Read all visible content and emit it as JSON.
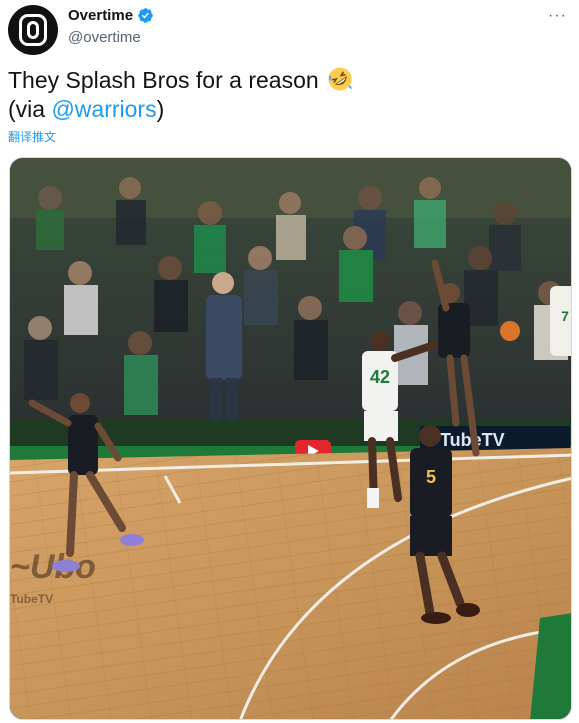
{
  "tweet": {
    "author": {
      "display_name": "Overtime",
      "handle": "@overtime",
      "verified": true,
      "avatar_icon": "overtime-logo-icon"
    },
    "more_label": "···",
    "text_line1": "They Splash Bros for a reason",
    "emoji_icon": "rolling-on-floor-laughing-icon",
    "via_prefix": "(via ",
    "mention": "@warriors",
    "via_suffix": ")",
    "translate_label": "翻译推文",
    "media": {
      "type": "video-frame",
      "scoreboard_brand": "TubeTV",
      "court_brand": "TubeTV",
      "jersey_number_white": "42",
      "jersey_number_dark": "5",
      "jersey_number_right": "7"
    }
  },
  "colors": {
    "link": "#1d9bf0",
    "text": "#0f1419",
    "secondary": "#536471",
    "court_wood": "#c8955a",
    "court_green": "#1f7a3a"
  }
}
